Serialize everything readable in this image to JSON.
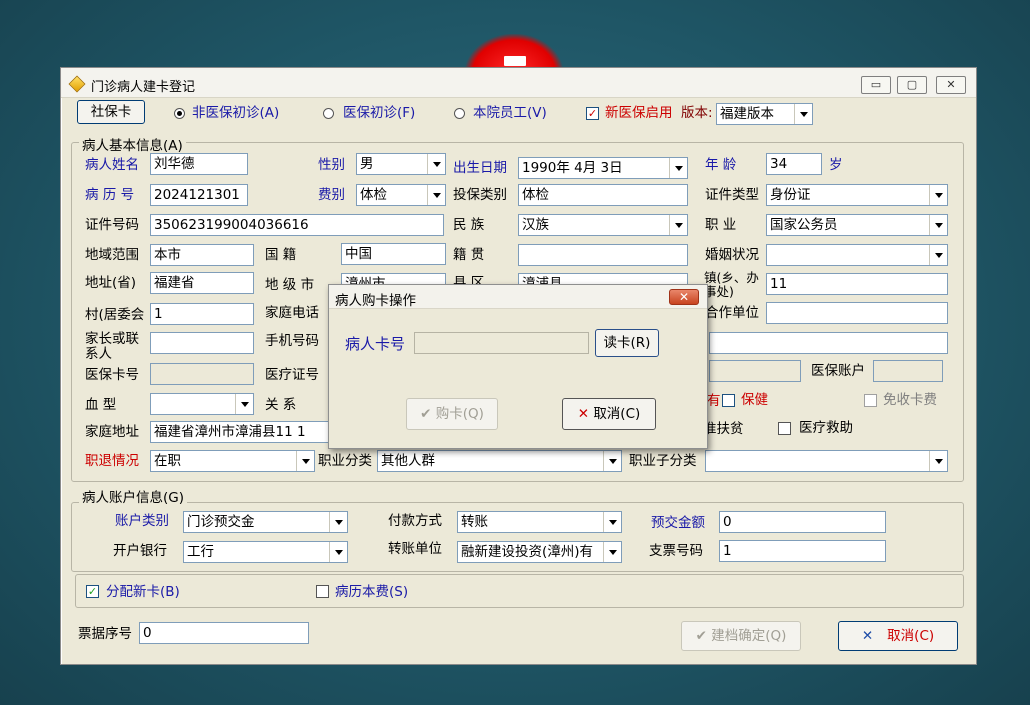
{
  "window": {
    "title": "门诊病人建卡登记",
    "controls": {
      "minimize": "▭",
      "maximize": "▢",
      "close": "✕"
    }
  },
  "toolbar": {
    "social_card": "社保卡",
    "radio1": "非医保初诊(A)",
    "radio2": "医保初诊(F)",
    "radio3": "本院员工(V)",
    "new_insurance": "新医保启用",
    "version_label": "版本:",
    "version_value": "福建版本"
  },
  "basic": {
    "group_title": "病人基本信息(A)",
    "name_label": "病人姓名",
    "name_value": "刘华德",
    "gender_label": "性别",
    "gender_value": "男",
    "birth_label": "出生日期",
    "birth_value": "1990年 4月 3日",
    "age_label": "年    龄",
    "age_value": "34",
    "age_unit": "岁",
    "record_label": "病 历 号",
    "record_value": "2024121301",
    "fee_label": "费别",
    "fee_value": "体检",
    "insure_type_label": "投保类别",
    "insure_type_value": "体检",
    "id_type_label": "证件类型",
    "id_type_value": "身份证",
    "id_no_label": "证件号码",
    "id_no_value": "350623199004036616",
    "nation_label": "民    族",
    "nation_value": "汉族",
    "job_label": "职    业",
    "job_value": "国家公务员",
    "region_label": "地域范围",
    "region_value": "本市",
    "country_label": "国    籍",
    "country_value": "中国",
    "native_label": "籍    贯",
    "native_value": "",
    "marriage_label": "婚姻状况",
    "marriage_value": "",
    "province_label": "地址(省)",
    "province_value": "福建省",
    "city_label": "地 级 市",
    "city_value": "漳州市",
    "county_label": "县    区",
    "county_value": "漳浦县",
    "street_label": "镇(乡、办事处)",
    "street_value": "11",
    "village_label": "村(居委会",
    "village_value": "1",
    "home_phone_label": "家庭电话",
    "coop_label": "合作单位",
    "guardian_label": "家长或联系人",
    "mobile_label": "手机号码",
    "insure_card_label": "医保卡号",
    "medical_cert_label": "医疗证号",
    "insure_account_label": "医保账户",
    "blood_label": "血    型",
    "blood_value": "",
    "relation_label": "关    系",
    "care_label": "保健",
    "free_fee_label": "免收卡费",
    "address_label": "家庭地址",
    "address_value": "福建省漳州市漳浦县11 1",
    "poverty_label": "准扶贫",
    "aid_label": "医疗救助",
    "retire_label": "职退情况",
    "retire_value": "在职",
    "job_class_label": "职业分类",
    "job_class_value": "其他人群",
    "job_sub_label": "职业子分类",
    "job_sub_value": ""
  },
  "account": {
    "group_title": "病人账户信息(G)",
    "type_label": "账户类别",
    "type_value": "门诊预交金",
    "pay_label": "付款方式",
    "pay_value": "转账",
    "prepay_label": "预交金额",
    "prepay_value": "0",
    "bank_label": "开户银行",
    "bank_value": "工行",
    "transfer_label": "转账单位",
    "transfer_value": "融新建设投资(漳州)有",
    "check_label": "支票号码",
    "check_value": "1"
  },
  "options": {
    "assign_card": "分配新卡(B)",
    "record_fee": "病历本费(S)"
  },
  "footer": {
    "receipt_label": "票据序号",
    "receipt_value": "0",
    "confirm": "建档确定(Q)",
    "cancel": "取消(C)"
  },
  "modal": {
    "title": "病人购卡操作",
    "card_label": "病人卡号",
    "card_value": "",
    "read_button": "读卡(R)",
    "buy_button": "购卡(Q)",
    "cancel_button": "取消(C)"
  },
  "colors": {
    "label_blue": "#1a1aa8",
    "label_red": "#cc0000",
    "window_bg": "#ece9d8"
  }
}
